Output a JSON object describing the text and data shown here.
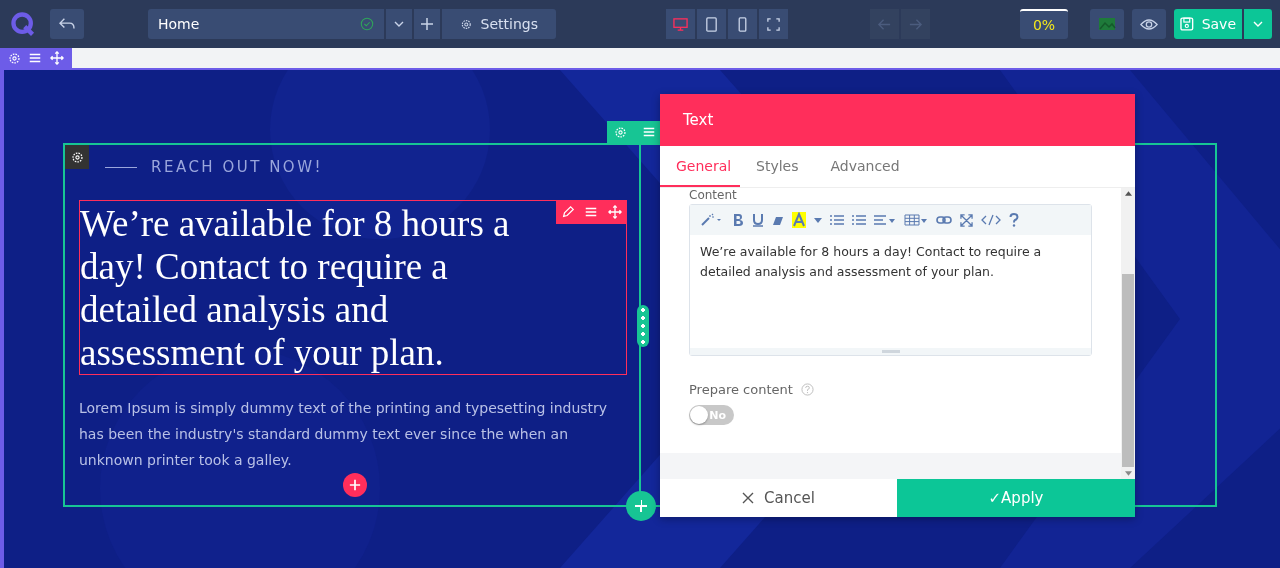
{
  "topbar": {
    "page": "Home",
    "settings": "Settings",
    "devices": [
      {
        "kind": "desktop",
        "selected": true
      },
      {
        "kind": "tablet",
        "selected": false
      },
      {
        "kind": "mobile",
        "selected": false
      },
      {
        "kind": "fullscreen",
        "selected": false
      }
    ],
    "progress": "0%",
    "save": "Save"
  },
  "section": {
    "eyebrow": "REACH OUT NOW!",
    "heading": "We’re available for 8 hours a day! Contact to require a detailed analysis and assessment of your plan.",
    "body": "Lorem Ipsum is simply dummy text of the printing and typesetting industry has been the industry's standard dummy text ever since the when an unknown printer took a galley."
  },
  "panel": {
    "title": "Text",
    "tabs": [
      {
        "label": "General",
        "selected": true
      },
      {
        "label": "Styles",
        "selected": false
      },
      {
        "label": "Advanced",
        "selected": false
      }
    ],
    "content_label": "Content",
    "editor_text": "We’re available for 8 hours a day! Contact to require a detailed analysis and assessment of your plan.",
    "prepare": {
      "label": "Prepare content",
      "on": false,
      "state_text": "No"
    },
    "cancel": "Cancel",
    "apply": "✓Apply"
  }
}
